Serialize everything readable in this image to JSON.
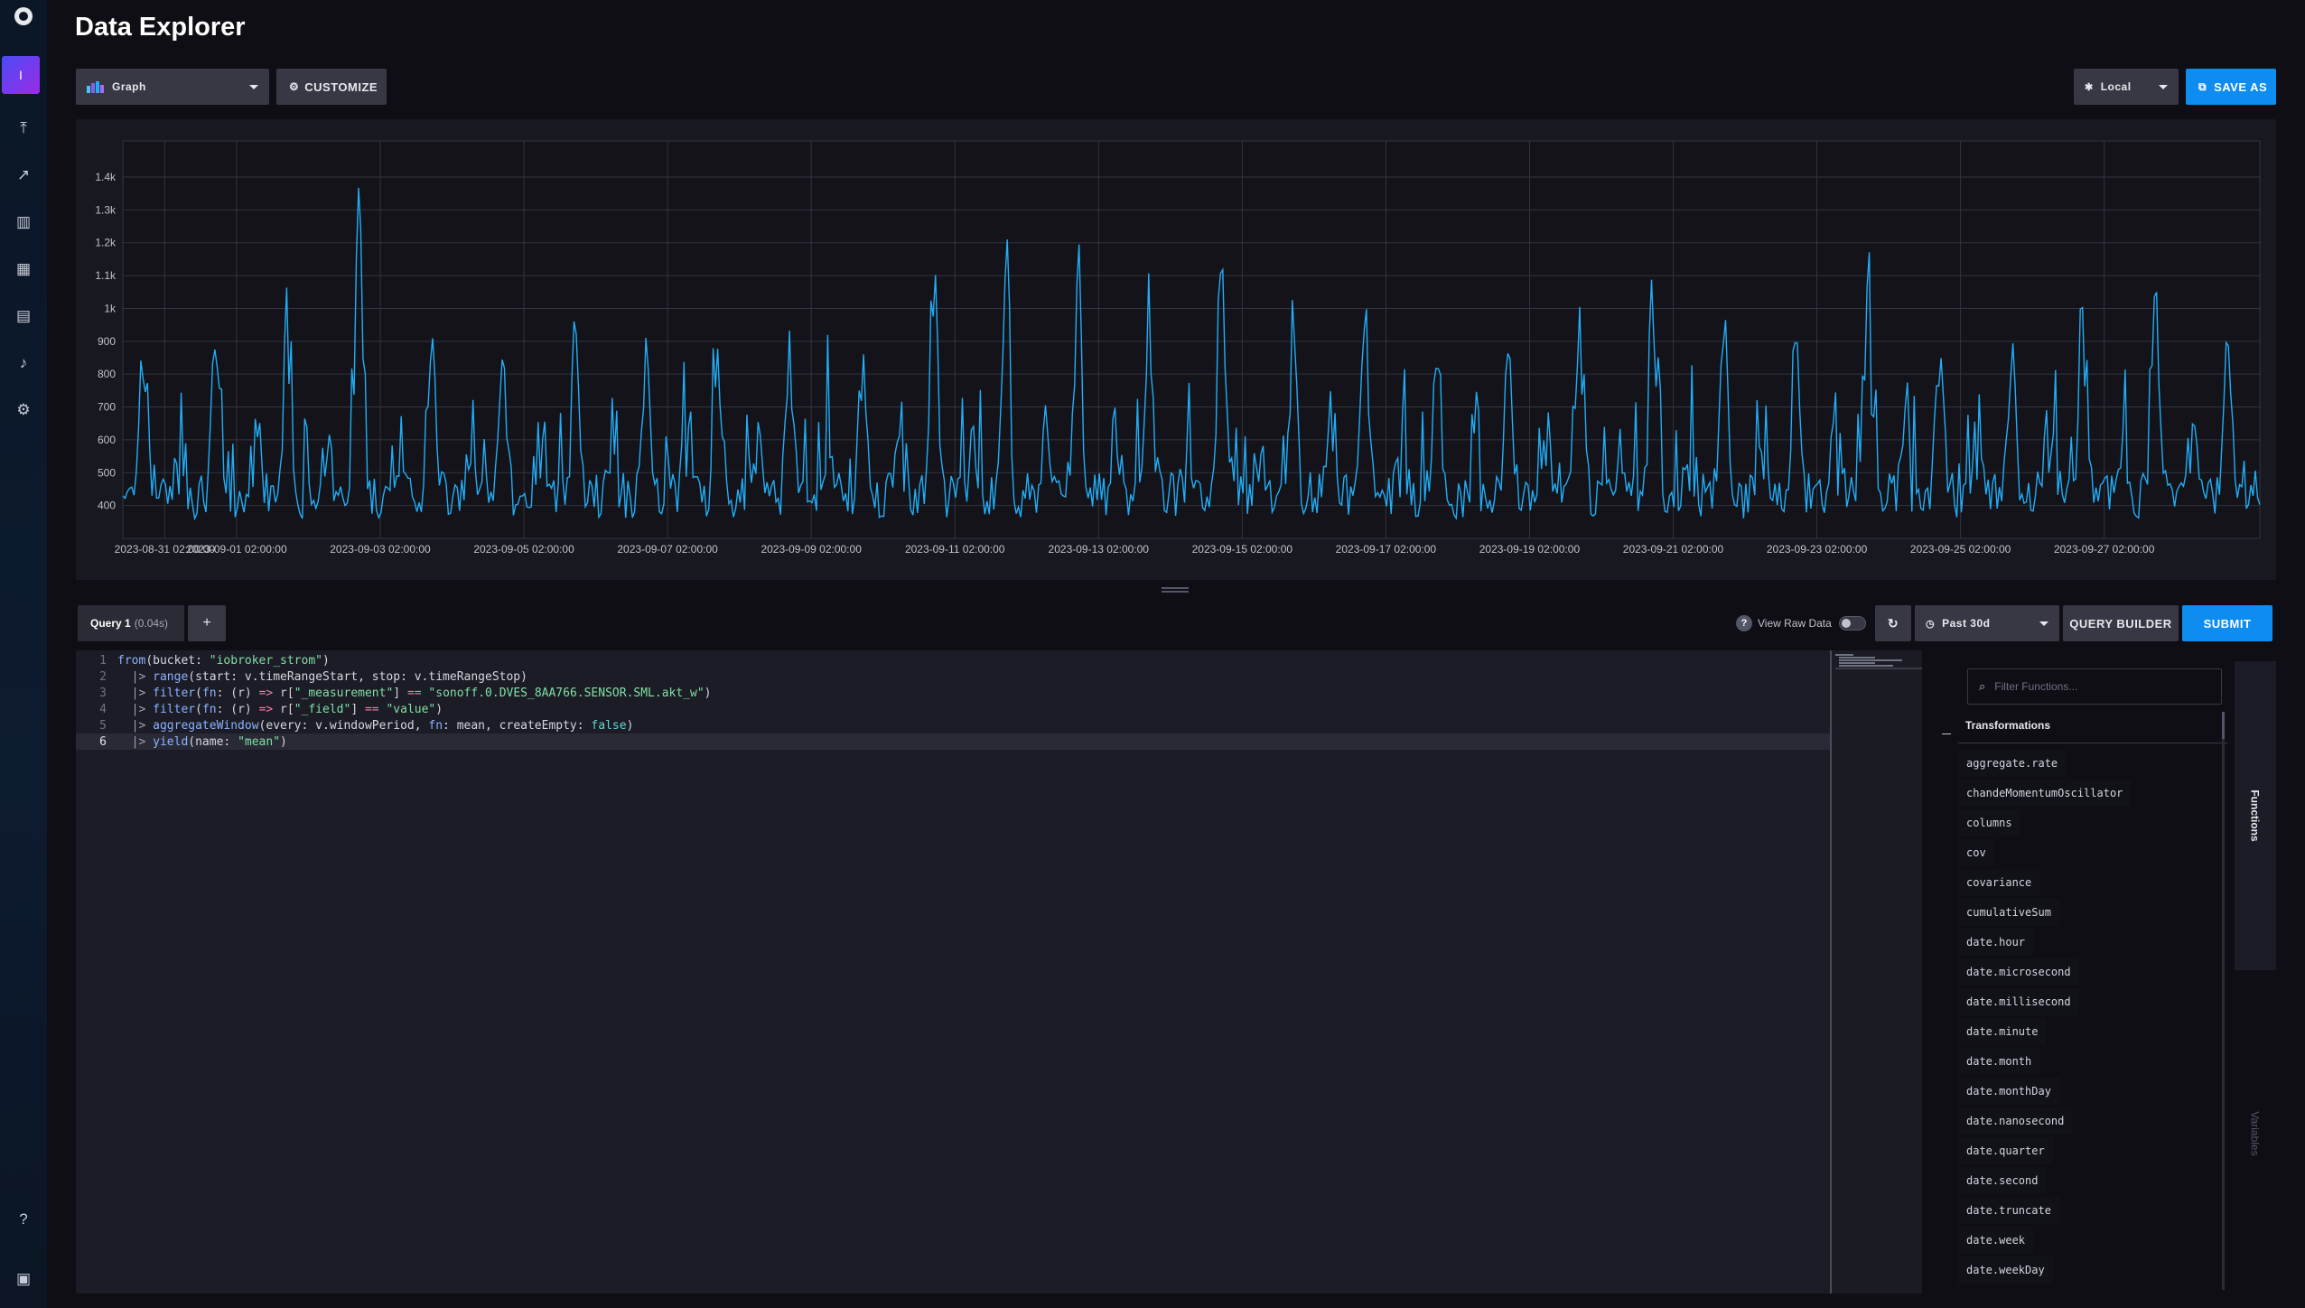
{
  "page": {
    "title": "Data Explorer"
  },
  "sidebar": {
    "active_label": "I",
    "items": [
      {
        "name": "upload-icon",
        "glyph": "⤒"
      },
      {
        "name": "chart-icon",
        "glyph": "↗"
      },
      {
        "name": "notebook-icon",
        "glyph": "▥"
      },
      {
        "name": "dashboards-icon",
        "glyph": "▦"
      },
      {
        "name": "tasks-icon",
        "glyph": "▤"
      },
      {
        "name": "alerts-icon",
        "glyph": "♪"
      },
      {
        "name": "settings-icon",
        "glyph": "⚙"
      }
    ],
    "help_glyph": "?",
    "bottom_glyph": "▣"
  },
  "toolbar": {
    "graph_type": "Graph",
    "customize_label": "CUSTOMIZE",
    "timezone_label": "Local",
    "save_as_label": "SAVE AS"
  },
  "chart_data": {
    "type": "line",
    "title": "",
    "xlabel": "",
    "ylabel": "",
    "y_ticks": [
      "400",
      "500",
      "600",
      "700",
      "800",
      "900",
      "1k",
      "1.1k",
      "1.2k",
      "1.3k",
      "1.4k"
    ],
    "ylim": [
      300,
      1510
    ],
    "x_ticks": [
      "2023-08-31 02:00:00",
      "2023-09-01 02:00:00",
      "2023-09-03 02:00:00",
      "2023-09-05 02:00:00",
      "2023-09-07 02:00:00",
      "2023-09-09 02:00:00",
      "2023-09-11 02:00:00",
      "2023-09-13 02:00:00",
      "2023-09-15 02:00:00",
      "2023-09-17 02:00:00",
      "2023-09-19 02:00:00",
      "2023-09-21 02:00:00",
      "2023-09-23 02:00:00",
      "2023-09-25 02:00:00",
      "2023-09-27 02:00:00"
    ],
    "x_start": "2023-08-30T12:00:00",
    "x_end": "2023-09-29T06:00:00",
    "grid": true,
    "series_color": "#22adf6",
    "daily_peaks": [
      1070,
      1000,
      1160,
      1480,
      1020,
      940,
      960,
      910,
      1020,
      1060,
      1020,
      1340,
      1300,
      1460,
      1100,
      1230,
      1020,
      1110,
      1010,
      1050,
      1070,
      1200,
      1110,
      1120,
      1310
    ]
  },
  "query": {
    "tab_label": "Query 1",
    "tab_time": "(0.04s)",
    "add_label": "+",
    "view_raw_label": "View Raw Data",
    "time_range": "Past 30d",
    "query_builder_label": "QUERY BUILDER",
    "submit_label": "SUBMIT",
    "code_lines": [
      "from(bucket: \"iobroker_strom\")",
      "  |> range(start: v.timeRangeStart, stop: v.timeRangeStop)",
      "  |> filter(fn: (r) => r[\"_measurement\"] == \"sonoff.0.DVES_8AA766.SENSOR.SML.akt_w\")",
      "  |> filter(fn: (r) => r[\"_field\"] == \"value\")",
      "  |> aggregateWindow(every: v.windowPeriod, fn: mean, createEmpty: false)",
      "  |> yield(name: \"mean\")"
    ]
  },
  "functions": {
    "search_placeholder": "Filter Functions...",
    "heading": "Transformations",
    "items": [
      "aggregate.rate",
      "chandeMomentumOscillator",
      "columns",
      "cov",
      "covariance",
      "cumulativeSum",
      "date.hour",
      "date.microsecond",
      "date.millisecond",
      "date.minute",
      "date.month",
      "date.monthDay",
      "date.nanosecond",
      "date.quarter",
      "date.second",
      "date.truncate",
      "date.week",
      "date.weekDay"
    ]
  },
  "side_tabs": {
    "functions": "Functions",
    "variables": "Variables"
  }
}
